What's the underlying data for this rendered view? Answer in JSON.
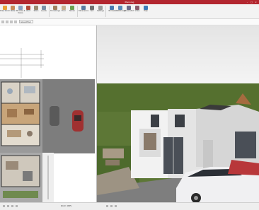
{
  "window": {
    "title": "Planning",
    "minimize": "–",
    "maximize": "□",
    "close": "×"
  },
  "ribbon": {
    "buttons": [
      {
        "label": "Draw Room",
        "color": "#e8a23a"
      },
      {
        "label": "Walls",
        "color": "#c88a5a"
      },
      {
        "label": "Windows & Doors",
        "color": "#8aa0c0"
      },
      {
        "label": "Roof",
        "color": "#b04a3a"
      },
      {
        "label": "Stairs",
        "color": "#9a8a70"
      },
      {
        "label": "Levels",
        "color": "#7a90a8"
      },
      {
        "label": "Furnishings",
        "color": "#a08060"
      },
      {
        "label": "Floor",
        "color": "#c8b090"
      },
      {
        "label": "Terrain",
        "color": "#6aa050"
      },
      {
        "label": "Dimensions",
        "color": "#5a7aa0"
      },
      {
        "label": "Text",
        "color": "#707070"
      },
      {
        "label": "Settings",
        "color": "#9a9a9a"
      },
      {
        "label": "3D View",
        "color": "#4a7ab0"
      },
      {
        "label": "Walkthrough",
        "color": "#5a8ab8"
      },
      {
        "label": "Screenshot",
        "color": "#6a6a8a"
      },
      {
        "label": "Video",
        "color": "#8a5a6a"
      },
      {
        "label": "Help",
        "color": "#3a7ab8"
      }
    ],
    "groups": [
      "Construct",
      "Interior",
      "View"
    ]
  },
  "quickbar": {
    "floor_select": "Ground floor"
  },
  "status": {
    "zoom": "Zoom: 100%"
  }
}
